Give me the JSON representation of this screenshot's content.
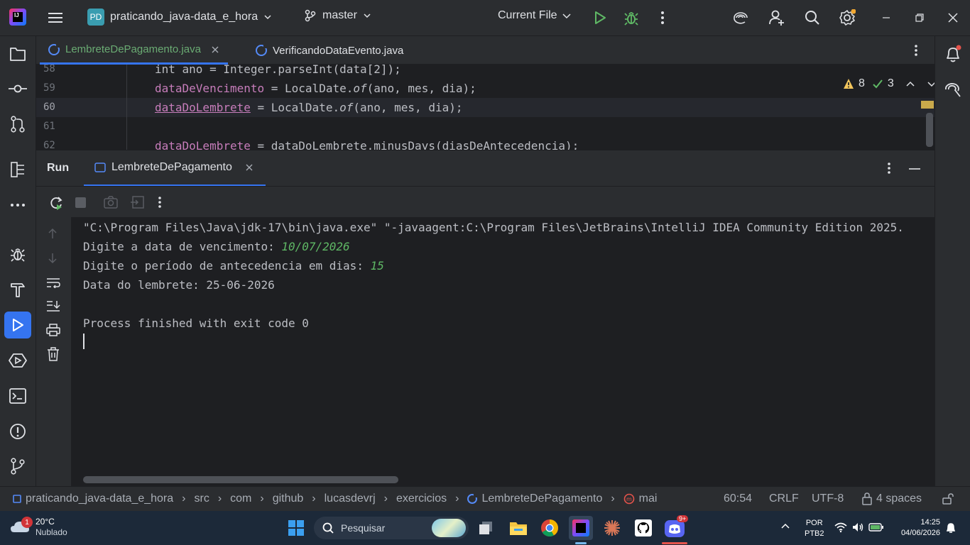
{
  "titlebar": {
    "project_initials": "PD",
    "project_name": "praticando_java-data_e_hora",
    "branch": "master",
    "run_config": "Current File"
  },
  "tabs": [
    {
      "label": "LembreteDePagamento.java",
      "active": true
    },
    {
      "label": "VerificandoDataEvento.java",
      "active": false
    }
  ],
  "editor": {
    "partial_top": "int ano = Integer.parseInt(data[2]);",
    "lines": [
      {
        "num": "59",
        "var": "dataDeVencimento",
        "rest": " = LocalDate.",
        "method": "of",
        "args": "(ano, mes, dia);"
      },
      {
        "num": "60",
        "var": "dataDoLembrete",
        "rest": " = LocalDate.",
        "method": "of",
        "args": "(ano, mes, dia);"
      },
      {
        "num": "61",
        "var": "",
        "rest": "",
        "method": "",
        "args": ""
      },
      {
        "num": "62",
        "var": "dataDoLembrete",
        "rest": " = dataDoLembrete.minusDays(diasDeAntecedencia);",
        "method": "",
        "args": ""
      }
    ],
    "partial_num": "58",
    "warnings": "8",
    "checks": "3"
  },
  "run": {
    "title": "Run",
    "tab": "LembreteDePagamento"
  },
  "console": {
    "cmd": "\"C:\\Program Files\\Java\\jdk-17\\bin\\java.exe\" \"-javaagent:C:\\Program Files\\JetBrains\\IntelliJ IDEA Community Edition 2025.",
    "prompt1": "Digite a data de vencimento: ",
    "input1": "10/07/2026",
    "prompt2": "Digite o período de antecedencia em dias: ",
    "input2": "15",
    "result": "Data do lembrete: 25-06-2026",
    "finished": "Process finished with exit code 0"
  },
  "statusbar": {
    "crumbs": [
      "praticando_java-data_e_hora",
      "src",
      "com",
      "github",
      "lucasdevrj",
      "exercicios",
      "LembreteDePagamento",
      "mai"
    ],
    "position": "60:54",
    "line_sep": "CRLF",
    "encoding": "UTF-8",
    "indent": "4 spaces"
  },
  "taskbar": {
    "weather_temp": "20°C",
    "weather_desc": "Nublado",
    "weather_badge": "1",
    "search_placeholder": "Pesquisar",
    "lang": "POR",
    "layout": "PTB2",
    "time": "14:25",
    "date": "04/06/2026",
    "discord_badge": "9+"
  },
  "colors": {
    "accent": "#3574f0",
    "bg": "#1e1f22",
    "panel": "#2b2d30",
    "input_green": "#5fb865",
    "var_purple": "#c77dbb"
  }
}
